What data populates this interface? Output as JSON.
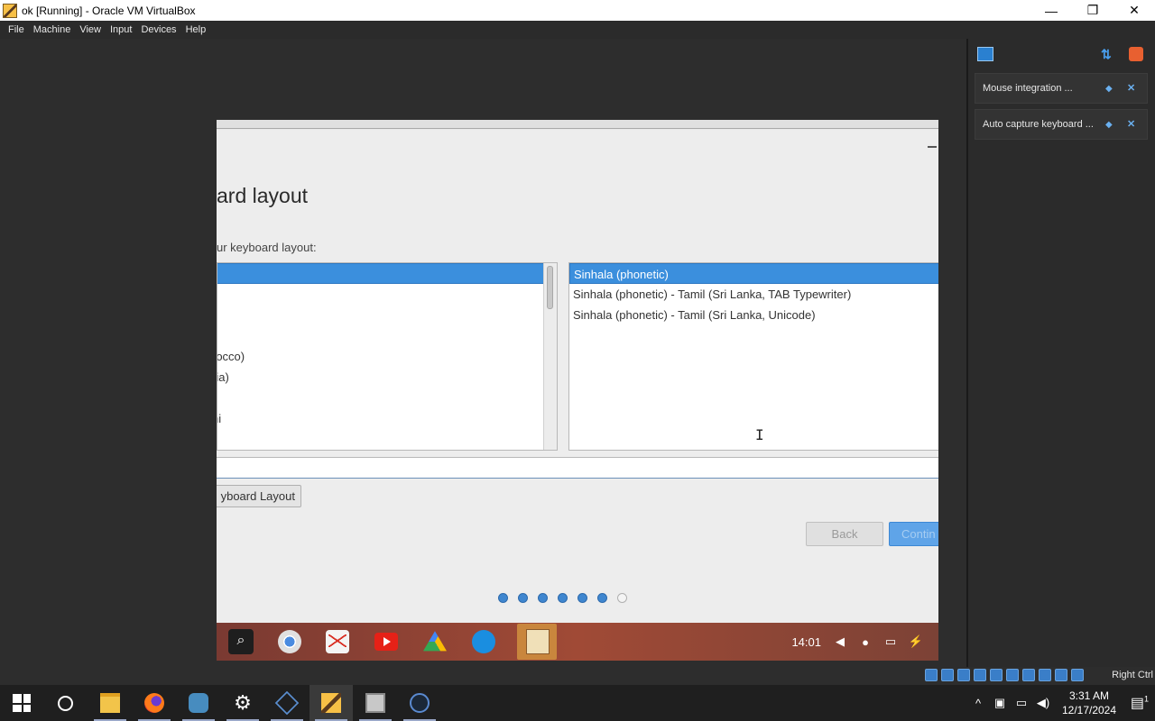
{
  "window": {
    "title": "ok [Running] - Oracle VM VirtualBox",
    "controls": [
      "—",
      "❐",
      "✕"
    ]
  },
  "menubar": [
    "File",
    "Machine",
    "View",
    "Input",
    "Devices",
    "Help"
  ],
  "guest": {
    "heading": "ard layout",
    "subheading": "ur keyboard layout:",
    "left_list": [
      "",
      "",
      "",
      "",
      "rocco)",
      "ria)",
      "",
      "hi",
      ""
    ],
    "left_selected_index": 0,
    "right_list": [
      "Sinhala (phonetic)",
      "Sinhala (phonetic) - Tamil (Sri Lanka, TAB Typewriter)",
      "Sinhala (phonetic) - Tamil (Sri Lanka, Unicode)"
    ],
    "right_selected_index": 0,
    "detect_button": "yboard Layout",
    "back_button": "Back",
    "continue_button": "Contin",
    "progress": {
      "total": 7,
      "completed": 6
    },
    "taskbar": {
      "time": "14:01",
      "apps": [
        "search-icon",
        "chrome-icon",
        "gmail-icon",
        "youtube-icon",
        "drive-icon",
        "files-icon",
        "installer-icon"
      ]
    }
  },
  "side_panel": {
    "notifications": [
      {
        "text": "Mouse integration ..."
      },
      {
        "text": "Auto capture keyboard ..."
      }
    ]
  },
  "vbox_status": {
    "host_key": "Right Ctrl"
  },
  "win_taskbar": {
    "clock_time": "3:31 AM",
    "clock_date": "12/17/2024",
    "notification_count": "1"
  }
}
